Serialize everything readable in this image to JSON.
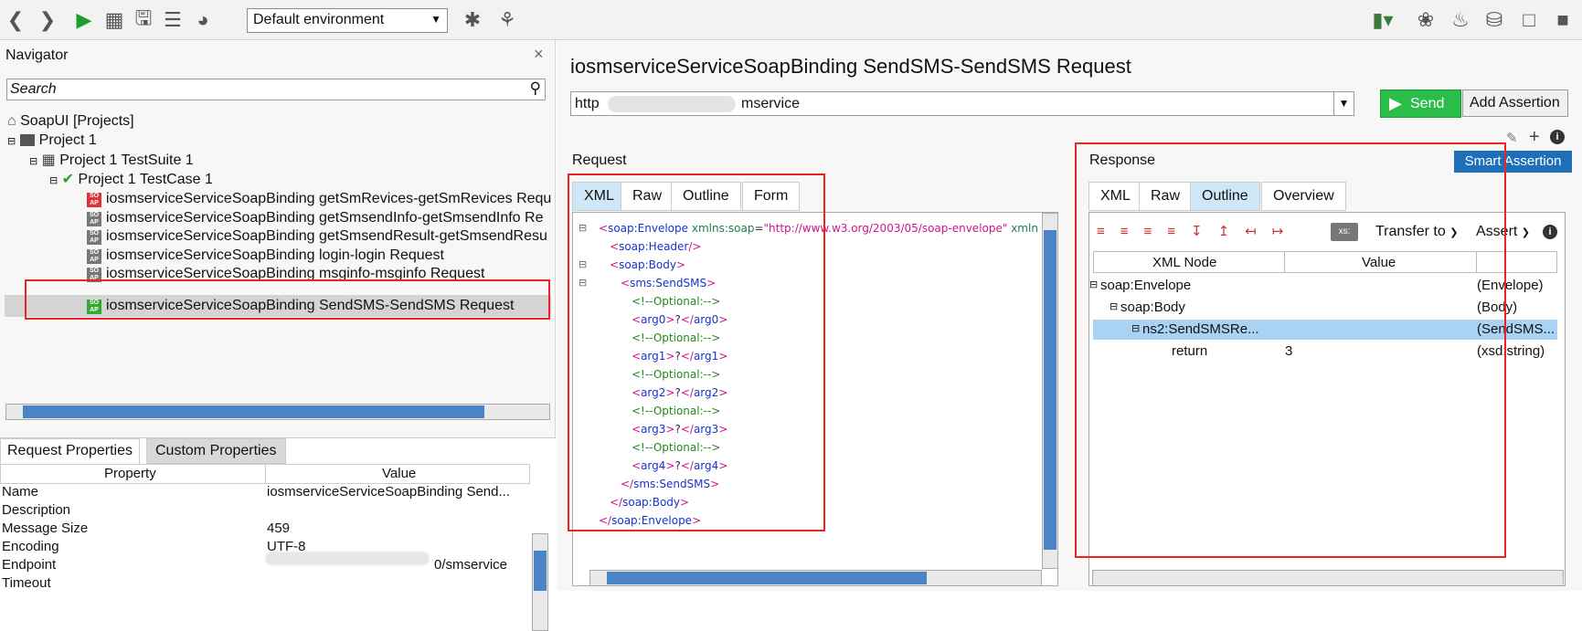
{
  "toolbar": {
    "environment": "Default environment"
  },
  "navigator": {
    "title": "Navigator",
    "search_placeholder": "Search",
    "tree": [
      {
        "label": "SoapUI [Projects]"
      },
      {
        "label": "Project 1"
      },
      {
        "label": "Project 1 TestSuite 1"
      },
      {
        "label": "Project 1 TestCase 1"
      },
      {
        "label": "iosmserviceServiceSoapBinding getSmRevices-getSmRevices Requ"
      },
      {
        "label": "iosmserviceServiceSoapBinding getSmsendInfo-getSmsendInfo Re"
      },
      {
        "label": "iosmserviceServiceSoapBinding getSmsendResult-getSmsendResu"
      },
      {
        "label": "iosmserviceServiceSoapBinding login-login Request"
      },
      {
        "label": "iosmserviceServiceSoapBinding msginfo-msginfo Request"
      },
      {
        "label": "iosmserviceServiceSoapBinding SendSMS-SendSMS Request"
      }
    ]
  },
  "properties": {
    "tabs": [
      "Request Properties",
      "Custom Properties"
    ],
    "headers": [
      "Property",
      "Value"
    ],
    "rows": [
      {
        "name": "Name",
        "value": "iosmserviceServiceSoapBinding Send..."
      },
      {
        "name": "Description",
        "value": ""
      },
      {
        "name": "Message Size",
        "value": "459"
      },
      {
        "name": "Encoding",
        "value": "UTF-8"
      },
      {
        "name": "Endpoint",
        "value": "0/smservice"
      },
      {
        "name": "Timeout",
        "value": ""
      }
    ]
  },
  "editor": {
    "title": "iosmserviceServiceSoapBinding SendSMS-SendSMS Request",
    "endpoint_prefix": "http",
    "endpoint_suffix": "mservice",
    "send_label": "Send",
    "add_assertion_label": "Add Assertion",
    "smart_assertion_label": "Smart Assertion"
  },
  "request": {
    "label": "Request",
    "tabs": [
      "XML",
      "Raw",
      "Outline",
      "Form"
    ],
    "xml_lines": [
      {
        "indent": 0,
        "parts": [
          {
            "c": "tg",
            "t": "<"
          },
          {
            "c": "el",
            "t": "soap:Envelope"
          },
          {
            "c": "at",
            "t": " xmlns:soap"
          },
          {
            "c": "tx",
            "t": "="
          },
          {
            "c": "tg",
            "t": "\"http://www.w3.org/2003/05/soap-envelope\""
          },
          {
            "c": "at",
            "t": " xmlns"
          }
        ]
      },
      {
        "indent": 1,
        "parts": [
          {
            "c": "tg",
            "t": "<"
          },
          {
            "c": "el",
            "t": "soap:Header"
          },
          {
            "c": "tg",
            "t": "/>"
          }
        ]
      },
      {
        "indent": 1,
        "parts": [
          {
            "c": "tg",
            "t": "<"
          },
          {
            "c": "el",
            "t": "soap:Body"
          },
          {
            "c": "tg",
            "t": ">"
          }
        ]
      },
      {
        "indent": 2,
        "parts": [
          {
            "c": "tg",
            "t": "<"
          },
          {
            "c": "el",
            "t": "sms:SendSMS"
          },
          {
            "c": "tg",
            "t": ">"
          }
        ]
      },
      {
        "indent": 3,
        "parts": [
          {
            "c": "cm",
            "t": "<!--Optional:-->"
          }
        ]
      },
      {
        "indent": 3,
        "parts": [
          {
            "c": "tg",
            "t": "<"
          },
          {
            "c": "el",
            "t": "arg0"
          },
          {
            "c": "tg",
            "t": ">"
          },
          {
            "c": "tx",
            "t": "?"
          },
          {
            "c": "tg",
            "t": "</"
          },
          {
            "c": "el",
            "t": "arg0"
          },
          {
            "c": "tg",
            "t": ">"
          }
        ]
      },
      {
        "indent": 3,
        "parts": [
          {
            "c": "cm",
            "t": "<!--Optional:-->"
          }
        ]
      },
      {
        "indent": 3,
        "parts": [
          {
            "c": "tg",
            "t": "<"
          },
          {
            "c": "el",
            "t": "arg1"
          },
          {
            "c": "tg",
            "t": ">"
          },
          {
            "c": "tx",
            "t": "?"
          },
          {
            "c": "tg",
            "t": "</"
          },
          {
            "c": "el",
            "t": "arg1"
          },
          {
            "c": "tg",
            "t": ">"
          }
        ]
      },
      {
        "indent": 3,
        "parts": [
          {
            "c": "cm",
            "t": "<!--Optional:-->"
          }
        ]
      },
      {
        "indent": 3,
        "parts": [
          {
            "c": "tg",
            "t": "<"
          },
          {
            "c": "el",
            "t": "arg2"
          },
          {
            "c": "tg",
            "t": ">"
          },
          {
            "c": "tx",
            "t": "?"
          },
          {
            "c": "tg",
            "t": "</"
          },
          {
            "c": "el",
            "t": "arg2"
          },
          {
            "c": "tg",
            "t": ">"
          }
        ]
      },
      {
        "indent": 3,
        "parts": [
          {
            "c": "cm",
            "t": "<!--Optional:-->"
          }
        ]
      },
      {
        "indent": 3,
        "parts": [
          {
            "c": "tg",
            "t": "<"
          },
          {
            "c": "el",
            "t": "arg3"
          },
          {
            "c": "tg",
            "t": ">"
          },
          {
            "c": "tx",
            "t": "?"
          },
          {
            "c": "tg",
            "t": "</"
          },
          {
            "c": "el",
            "t": "arg3"
          },
          {
            "c": "tg",
            "t": ">"
          }
        ]
      },
      {
        "indent": 3,
        "parts": [
          {
            "c": "cm",
            "t": "<!--Optional:-->"
          }
        ]
      },
      {
        "indent": 3,
        "parts": [
          {
            "c": "tg",
            "t": "<"
          },
          {
            "c": "el",
            "t": "arg4"
          },
          {
            "c": "tg",
            "t": ">"
          },
          {
            "c": "tx",
            "t": "?"
          },
          {
            "c": "tg",
            "t": "</"
          },
          {
            "c": "el",
            "t": "arg4"
          },
          {
            "c": "tg",
            "t": ">"
          }
        ]
      },
      {
        "indent": 2,
        "parts": [
          {
            "c": "tg",
            "t": "</"
          },
          {
            "c": "el",
            "t": "sms:SendSMS"
          },
          {
            "c": "tg",
            "t": ">"
          }
        ]
      },
      {
        "indent": 1,
        "parts": [
          {
            "c": "tg",
            "t": "</"
          },
          {
            "c": "el",
            "t": "soap:Body"
          },
          {
            "c": "tg",
            "t": ">"
          }
        ]
      },
      {
        "indent": 0,
        "parts": [
          {
            "c": "tg",
            "t": "</"
          },
          {
            "c": "el",
            "t": "soap:Envelope"
          },
          {
            "c": "tg",
            "t": ">"
          }
        ]
      }
    ]
  },
  "response": {
    "label": "Response",
    "tabs": [
      "XML",
      "Raw",
      "Outline",
      "Overview"
    ],
    "transfer_label": "Transfer to",
    "assert_label": "Assert",
    "xs_label": "xs:",
    "grid_headers": [
      "XML Node",
      "Value",
      ""
    ],
    "grid_rows": [
      {
        "node": "soap:Envelope",
        "value": "",
        "type": "(Envelope)"
      },
      {
        "node": "soap:Body",
        "value": "",
        "type": "(Body)"
      },
      {
        "node": "ns2:SendSMSRe...",
        "value": "",
        "type": "(SendSMS..."
      },
      {
        "node": "return",
        "value": "3",
        "type": "(xsd:string)"
      }
    ]
  }
}
